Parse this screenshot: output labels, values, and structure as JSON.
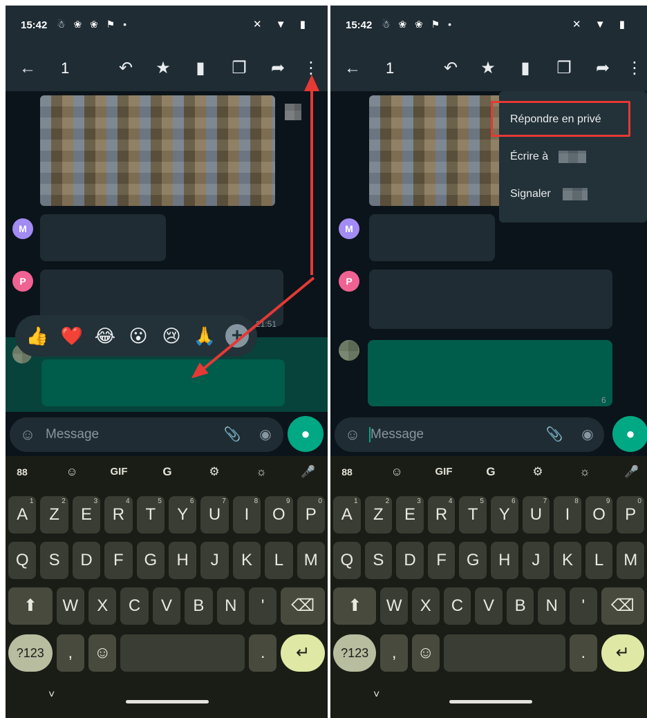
{
  "status": {
    "time": "15:42",
    "left_icons": "☃ ❀ ❀ ⚑ •",
    "right_icons": "✕ ▼ ▮"
  },
  "appbar": {
    "selected_count": "1"
  },
  "avatars": [
    {
      "letter": "M",
      "color": "#a28bf2"
    },
    {
      "letter": "P",
      "color": "#f06292"
    }
  ],
  "messages": {
    "time_1": "21:51",
    "time_2": "6"
  },
  "reactions": [
    "👍",
    "❤️",
    "😂",
    "😮",
    "😢",
    "🙏"
  ],
  "reaction_more": "+",
  "menu": {
    "items": [
      "Répondre en privé",
      "Écrire à",
      "Signaler"
    ]
  },
  "composer": {
    "placeholder": "Message"
  },
  "keyboard": {
    "toolbar": [
      "88",
      "☺",
      "GIF",
      "G",
      "⚙",
      "☼",
      "🎤"
    ],
    "row1": [
      "A",
      "Z",
      "E",
      "R",
      "T",
      "Y",
      "U",
      "I",
      "O",
      "P"
    ],
    "row1_hints": [
      "1",
      "2",
      "3",
      "4",
      "5",
      "6",
      "7",
      "8",
      "9",
      "0"
    ],
    "row2": [
      "Q",
      "S",
      "D",
      "F",
      "G",
      "H",
      "J",
      "K",
      "L",
      "M"
    ],
    "row3": [
      "W",
      "X",
      "C",
      "V",
      "B",
      "N",
      "'"
    ],
    "shift": "⬆",
    "backspace": "⌫",
    "numbers": "?123",
    "comma": ",",
    "emoji": "☺",
    "period": ".",
    "enter": "↵"
  },
  "nav": {
    "hide_keyboard": "˅"
  },
  "colors": {
    "accent": "#00a884",
    "annotation": "#e53935",
    "header": "#1f2c34"
  }
}
